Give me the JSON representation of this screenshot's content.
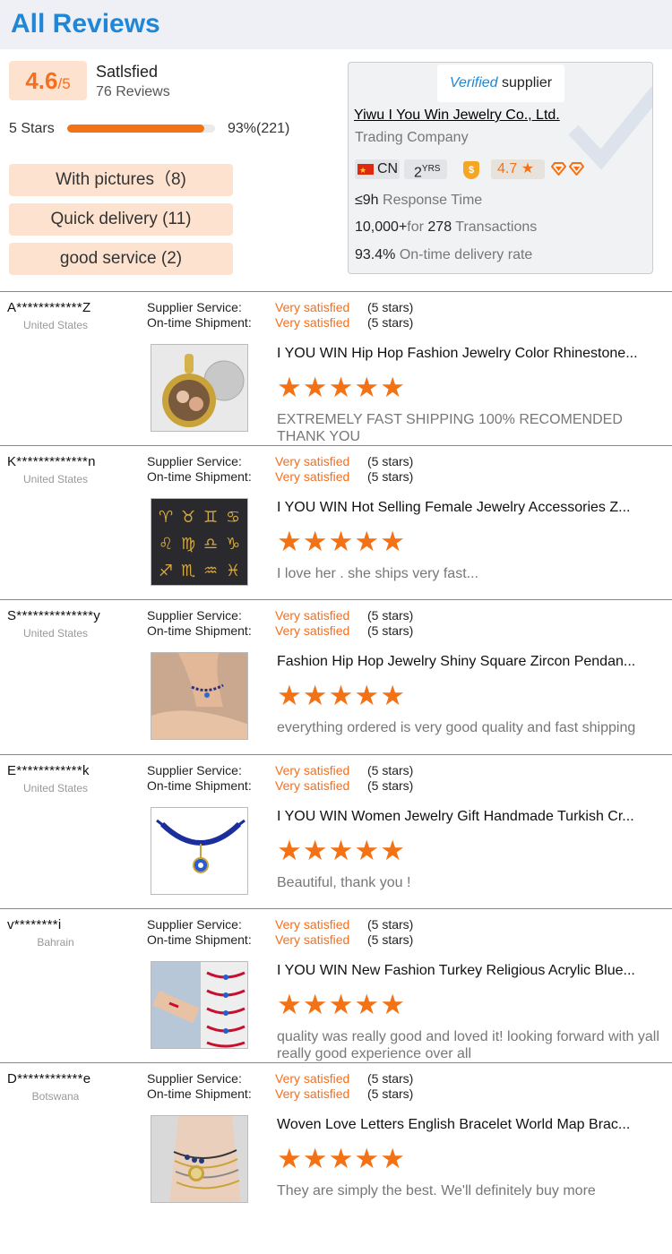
{
  "header": {
    "title": "All Reviews"
  },
  "summary": {
    "score": "4.6",
    "score_suffix": "/5",
    "label": "Satlsfied",
    "reviews": "76 Reviews",
    "stars_label": "5 Stars",
    "stars_fraction": 0.93,
    "stars_percent": "93%(221)"
  },
  "tags": [
    {
      "label": "With pictures（8)"
    },
    {
      "label": "Quick delivery (11)"
    },
    {
      "label": "good service (2)"
    }
  ],
  "supplier": {
    "verified_part1": "Verified",
    "verified_part2": " supplier",
    "company": "Yiwu I You Win Jewelry Co., Ltd.",
    "type": "Trading Company",
    "country": "CN",
    "years": "2",
    "years_unit": "YRS",
    "rating": "4.7 ★",
    "response_value": "≤9h",
    "response_label": " Response Time",
    "transactions_value1": "10,000+",
    "transactions_mid": "for ",
    "transactions_value2": "278",
    "transactions_label": " Transactions",
    "delivery_value": "93.4%",
    "delivery_label": " On-time delivery rate",
    "colors": {
      "accent": "#f46f1f",
      "brand": "#1f87d6"
    }
  },
  "review_labels": {
    "service": "Supplier Service:",
    "shipment": "On-time Shipment:"
  },
  "reviews": [
    {
      "name": "A************Z",
      "country": "United States",
      "service": "Very satisfied",
      "service_stars": "(5 stars)",
      "shipment": "Very satisfied",
      "shipment_stars": "(5 stars)",
      "product": "I YOU WIN Hip Hop Fashion Jewelry Color Rhinestone...",
      "rating": 5,
      "comment": "EXTREMELY FAST SHIPPING 100% RECOMENDED THANK YOU",
      "image": "photo-pendant"
    },
    {
      "name": "K*************n",
      "country": "United States",
      "service": "Very satisfied",
      "service_stars": "(5 stars)",
      "shipment": "Very satisfied",
      "shipment_stars": "(5 stars)",
      "product": "I YOU WIN Hot Selling Female Jewelry Accessories Z...",
      "rating": 5,
      "comment": "I love her . she ships very fast...",
      "image": "zodiac-charms"
    },
    {
      "name": "S**************y",
      "country": "United States",
      "service": "Very satisfied",
      "service_stars": "(5 stars)",
      "shipment": "Very satisfied",
      "shipment_stars": "(5 stars)",
      "product": "Fashion Hip Hop Jewelry Shiny Square Zircon Pendan...",
      "rating": 5,
      "comment": "everything ordered is very good quality and fast shipping",
      "image": "anklet"
    },
    {
      "name": "E************k",
      "country": "United States",
      "service": "Very satisfied",
      "service_stars": "(5 stars)",
      "shipment": "Very satisfied",
      "shipment_stars": "(5 stars)",
      "product": "I YOU WIN Women Jewelry Gift Handmade Turkish Cr...",
      "rating": 5,
      "comment": "Beautiful, thank you !",
      "image": "blue-bracelet"
    },
    {
      "name": "v********i",
      "country": "Bahrain",
      "service": "Very satisfied",
      "service_stars": "(5 stars)",
      "shipment": "Very satisfied",
      "shipment_stars": "(5 stars)",
      "product": "I YOU WIN New Fashion Turkey Religious Acrylic Blue...",
      "rating": 5,
      "comment": "quality was really good and loved it! looking forward with yall really good experience over all",
      "image": "red-bracelets"
    },
    {
      "name": "D************e",
      "country": "Botswana",
      "service": "Very satisfied",
      "service_stars": "(5 stars)",
      "shipment": "Very satisfied",
      "shipment_stars": "(5 stars)",
      "product": "Woven Love Letters English Bracelet World Map Brac...",
      "rating": 5,
      "comment": "They are simply the best. We'll definitely buy more",
      "image": "map-bracelet"
    }
  ]
}
